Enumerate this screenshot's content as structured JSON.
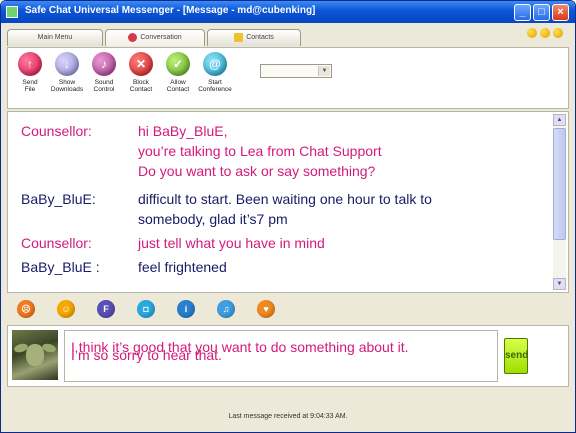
{
  "window": {
    "title": "Safe Chat Universal Messenger - [Message - md@cubenking]",
    "controls": {
      "minimize": "_",
      "maximize": "□",
      "close": "×"
    }
  },
  "tabs": [
    {
      "label": "Main Menu",
      "icon": ""
    },
    {
      "label": "Conversation",
      "icon": "chat-bubble-icon"
    },
    {
      "label": "Contacts",
      "icon": "folder-icon"
    }
  ],
  "toolbar": {
    "buttons": [
      {
        "label": "Send\nFile",
        "icon": "send-file-icon",
        "glyph": "↑",
        "color": "#d21349"
      },
      {
        "label": "Show\nDownloads",
        "icon": "downloads-icon",
        "glyph": "↓",
        "color": "#8c86d6"
      },
      {
        "label": "Sound\nControl",
        "icon": "speaker-icon",
        "glyph": "♪",
        "color": "#a3358a"
      },
      {
        "label": "Block\nContact",
        "icon": "block-icon",
        "glyph": "✕",
        "color": "#cc1f1f"
      },
      {
        "label": "Allow\nContact",
        "icon": "allow-icon",
        "glyph": "✓",
        "color": "#5aa61a"
      },
      {
        "label": "Start\nConference",
        "icon": "conference-icon",
        "glyph": "@",
        "color": "#1a9cc9"
      }
    ],
    "status_combo_value": ""
  },
  "transcript": {
    "messages": [
      {
        "speaker": "Counsellor:",
        "role": "counsellor",
        "lines": [
          "hi BaBy_BluE,",
          "you’re talking to Lea from Chat Support",
          "Do you want to ask or say something?"
        ]
      },
      {
        "speaker": "BaBy_BluE:",
        "role": "user",
        "lines": [
          "difficult to start. Been waiting one hour to talk to",
          "somebody, glad it’s7 pm"
        ]
      },
      {
        "speaker": "Counsellor:",
        "role": "counsellor",
        "lines": [
          "just tell what you have in mind"
        ]
      },
      {
        "speaker": "BaBy_BluE :",
        "role": "user",
        "lines": [
          "feel frightened"
        ]
      }
    ]
  },
  "emoticons": [
    {
      "icon": "angry-smiley-icon",
      "glyph": "☹",
      "color": "#f07a20"
    },
    {
      "icon": "happy-smiley-icon",
      "glyph": "☺",
      "color": "#f5a800"
    },
    {
      "icon": "f-badge-icon",
      "glyph": "F",
      "color": "#5a4fb8"
    },
    {
      "icon": "chat-badge-icon",
      "glyph": "◘",
      "color": "#2aa9e0"
    },
    {
      "icon": "info-badge-icon",
      "glyph": "i",
      "color": "#2a7fd0"
    },
    {
      "icon": "music-badge-icon",
      "glyph": "♫",
      "color": "#3f9fe0"
    },
    {
      "icon": "heart-badge-icon",
      "glyph": "♥",
      "color": "#f08a20"
    }
  ],
  "compose": {
    "text": "I think it’s good that you want to do something about it.",
    "overlay_text": "I’m so sorry to hear that.",
    "send_label": "send"
  },
  "status": {
    "text": "Last message received at 9:04:33 AM."
  }
}
